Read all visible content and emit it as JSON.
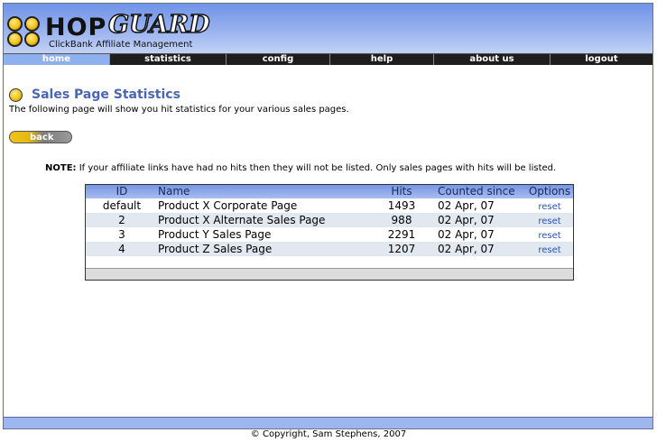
{
  "brand": {
    "name_left": "HOP",
    "name_right": "GUARD",
    "tagline": "ClickBank Affiliate Management"
  },
  "nav": {
    "items": [
      {
        "label": "home",
        "active": true
      },
      {
        "label": "statistics",
        "active": false
      },
      {
        "label": "config",
        "active": false
      },
      {
        "label": "help",
        "active": false
      },
      {
        "label": "about us",
        "active": false
      },
      {
        "label": "logout",
        "active": false
      }
    ]
  },
  "page": {
    "title": "Sales Page Statistics",
    "intro": "The following page will show you hit statistics for your various sales pages.",
    "back_label": "back",
    "note_label": "NOTE:",
    "note_text": "If your affiliate links have had no hits then they will not be listed. Only sales pages with hits will be listed."
  },
  "table": {
    "headers": {
      "id": "ID",
      "name": "Name",
      "hits": "Hits",
      "counted_since": "Counted since",
      "options": "Options"
    },
    "rows": [
      {
        "id": "default",
        "name": "Product X Corporate Page",
        "hits": "1493",
        "counted_since": "02 Apr, 07",
        "option": "reset"
      },
      {
        "id": "2",
        "name": "Product X Alternate Sales Page",
        "hits": "988",
        "counted_since": "02 Apr, 07",
        "option": "reset"
      },
      {
        "id": "3",
        "name": "Product Y Sales Page",
        "hits": "2291",
        "counted_since": "02 Apr, 07",
        "option": "reset"
      },
      {
        "id": "4",
        "name": "Product Z Sales Page",
        "hits": "1207",
        "counted_since": "02 Apr, 07",
        "option": "reset"
      }
    ]
  },
  "footer": {
    "copyright": "© Copyright, Sam Stephens, 2007"
  },
  "colors": {
    "header_blue": "#9ab3ef",
    "title_blue": "#4a66b2",
    "link_blue": "#2850b8",
    "accent_yellow": "#f2c418"
  }
}
